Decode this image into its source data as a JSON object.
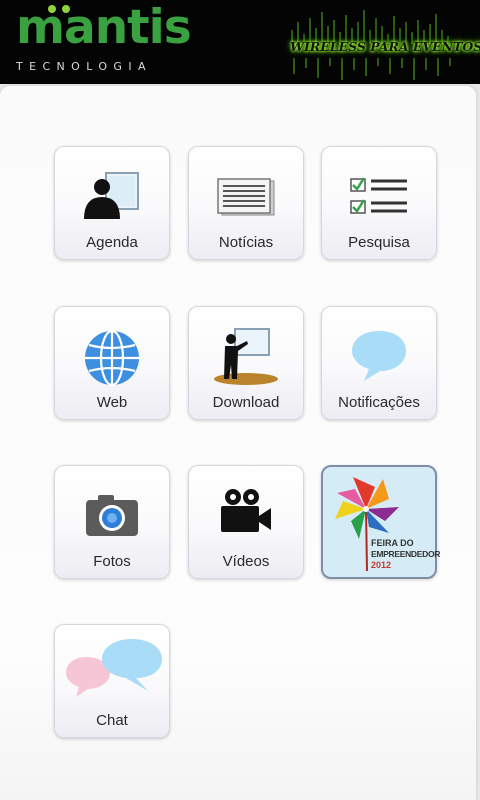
{
  "header": {
    "brand": "mantis",
    "brand_sub": "TECNOLOGIA",
    "tagline": "WIRELESS PARA EVENTOS"
  },
  "tiles": [
    {
      "label": "Agenda",
      "icon": "person-screen-icon"
    },
    {
      "label": "Notícias",
      "icon": "newspaper-icon"
    },
    {
      "label": "Pesquisa",
      "icon": "checklist-icon"
    },
    {
      "label": "Web",
      "icon": "globe-icon"
    },
    {
      "label": "Download",
      "icon": "presenter-board-icon"
    },
    {
      "label": "Notificações",
      "icon": "speech-bubble-icon"
    },
    {
      "label": "Fotos",
      "icon": "camera-icon"
    },
    {
      "label": "Vídeos",
      "icon": "video-camera-icon"
    },
    {
      "label": "",
      "icon": "pinwheel-logo-icon"
    },
    {
      "label": "Chat",
      "icon": "chat-bubbles-icon"
    }
  ],
  "event_logo": {
    "line1": "FEIRA DO",
    "line2": "EMPREENDEDOR",
    "year": "2012"
  },
  "colors": {
    "brand_green": "#3aa141",
    "glow_green": "#9ef23a",
    "bubble_blue": "#a9dcf7",
    "bubble_pink": "#f7c6d6"
  }
}
